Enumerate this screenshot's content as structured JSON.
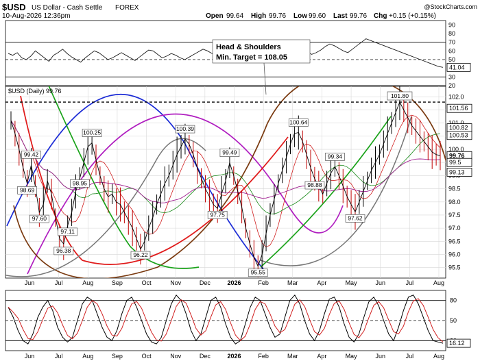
{
  "header": {
    "symbol": "$USD",
    "name": "US Dollar - Cash Settle",
    "exchange": "FOREX",
    "date": "10-Aug-2026 12:36pm",
    "open_label": "Open",
    "open": "99.64",
    "high_label": "High",
    "high": "99.76",
    "low_label": "Low",
    "low": "99.60",
    "last_label": "Last",
    "last": "99.76",
    "chg_label": "Chg",
    "chg": "+0.15 (+0.15%)",
    "watermark": "@StockCharts.com"
  },
  "annotation": {
    "line1": "Head & Shoulders",
    "line2": "Min. Target = 108.05"
  },
  "chart_data": [
    {
      "type": "line",
      "panel": "upper indicator (RSI)",
      "y_ticks": [
        20,
        30,
        40,
        50,
        60,
        70,
        80,
        90
      ],
      "ylim": [
        20,
        95
      ],
      "reference_lines": [
        30,
        50,
        70
      ],
      "last_value_label": "41.04",
      "series": [
        {
          "values": [
            57,
            55,
            58,
            52,
            50,
            54,
            60,
            56,
            52,
            48,
            55,
            58,
            62,
            57,
            53,
            50,
            47,
            52,
            56,
            60,
            58,
            54,
            50,
            52,
            55,
            58,
            55,
            52,
            49,
            53,
            57,
            61,
            60,
            56,
            52,
            54,
            57,
            55,
            52,
            50,
            53,
            56,
            59,
            62,
            60,
            57,
            54,
            52,
            55,
            58,
            60,
            58,
            55,
            52,
            50,
            53,
            56,
            58,
            56,
            54,
            52,
            55,
            58,
            61,
            64,
            62,
            59,
            56,
            58,
            61,
            65,
            68,
            66,
            63,
            60,
            58,
            62,
            66,
            70,
            74,
            72,
            70,
            68,
            66,
            64,
            62,
            60,
            58,
            56,
            54,
            52,
            50,
            48,
            46,
            44,
            42,
            41.04
          ]
        }
      ]
    },
    {
      "type": "line",
      "panel": "price",
      "title": "$USD (Daily) 99.76",
      "x_axis_labels": [
        "Jun",
        "Jul",
        "Aug",
        "Sep",
        "Oct",
        "Nov",
        "Dec",
        "2026",
        "Feb",
        "Mar",
        "Apr",
        "May",
        "Jun",
        "Jul",
        "Aug"
      ],
      "y_ticks": [
        95.5,
        96.0,
        96.5,
        97.0,
        97.5,
        98.0,
        98.5,
        99.0,
        99.5,
        100.0,
        100.5,
        101.0,
        101.5,
        102.0
      ],
      "ylim": [
        95.1,
        102.4
      ],
      "neckline": 101.8,
      "neckline_label": "101.80",
      "value_tags": [
        "101.56",
        "100.82",
        "100.53",
        "99.76",
        "99.5",
        "99.13"
      ],
      "series": [
        {
          "name": "$USD (Daily)",
          "values": [
            101.1,
            100.6,
            100.0,
            99.3,
            98.7,
            99.4,
            98.6,
            97.6,
            97.9,
            98.8,
            98.3,
            97.4,
            96.6,
            96.4,
            97.1,
            97.6,
            98.4,
            98.9,
            99.5,
            100.1,
            100.25,
            99.6,
            99.0,
            98.5,
            98.2,
            98.3,
            98.0,
            97.9,
            97.6,
            97.3,
            97.0,
            96.6,
            96.2,
            96.5,
            97.0,
            97.4,
            97.9,
            98.3,
            98.7,
            99.0,
            99.4,
            99.8,
            100.1,
            100.39,
            100.2,
            99.8,
            99.3,
            98.9,
            98.5,
            98.2,
            97.9,
            97.75,
            98.3,
            98.8,
            99.49,
            99.0,
            98.4,
            97.8,
            97.0,
            96.4,
            95.9,
            95.55,
            96.0,
            96.8,
            97.5,
            98.1,
            98.7,
            99.2,
            99.7,
            100.2,
            100.6,
            100.64,
            100.3,
            99.8,
            99.3,
            98.88,
            98.6,
            98.3,
            98.7,
            99.1,
            99.34,
            99.0,
            98.6,
            98.2,
            97.9,
            97.62,
            98.0,
            98.4,
            98.8,
            99.2,
            99.5,
            99.8,
            100.2,
            100.6,
            101.0,
            101.4,
            101.8,
            101.5,
            101.2,
            100.9,
            100.7,
            100.5,
            100.3,
            100.1,
            99.9,
            99.8,
            99.76
          ]
        }
      ],
      "point_labels": [
        {
          "text": "100.25",
          "value": 100.25
        },
        {
          "text": "99.42",
          "value": 99.42
        },
        {
          "text": "98.95",
          "value": 98.95
        },
        {
          "text": "98.69",
          "value": 98.69
        },
        {
          "text": "97.60",
          "value": 97.6
        },
        {
          "text": "97.11",
          "value": 97.11
        },
        {
          "text": "96.38",
          "value": 96.38
        },
        {
          "text": "96.22",
          "value": 96.22
        },
        {
          "text": "100.39",
          "value": 100.39
        },
        {
          "text": "99.49",
          "value": 99.49
        },
        {
          "text": "97.75",
          "value": 97.75
        },
        {
          "text": "95.55",
          "value": 95.55
        },
        {
          "text": "100.64",
          "value": 100.64
        },
        {
          "text": "98.88",
          "value": 98.88
        },
        {
          "text": "99.34",
          "value": 99.34
        },
        {
          "text": "97.62",
          "value": 97.62
        }
      ]
    },
    {
      "type": "line",
      "panel": "lower indicator (stochastic)",
      "x_axis_labels": [
        "Jun",
        "Jul",
        "Aug",
        "Sep",
        "Oct",
        "Nov",
        "Dec",
        "2026",
        "Feb",
        "Mar",
        "Apr",
        "May",
        "Jun",
        "Jul",
        "Aug"
      ],
      "y_ticks": [
        20,
        50,
        80
      ],
      "ylim": [
        5,
        95
      ],
      "reference_lines": [
        20,
        50,
        80
      ],
      "last_value_label": "16.12",
      "series": [
        {
          "values": [
            70,
            55,
            35,
            20,
            15,
            30,
            55,
            70,
            80,
            65,
            40,
            25,
            18,
            25,
            50,
            75,
            85,
            80,
            60,
            40,
            25,
            20,
            35,
            60,
            80,
            85,
            70,
            50,
            30,
            18,
            15,
            25,
            50,
            75,
            88,
            80,
            60,
            35,
            20,
            30,
            55,
            80,
            85,
            70,
            45,
            25,
            15,
            20,
            45,
            70,
            85,
            80,
            60,
            40,
            25,
            30,
            55,
            80,
            88,
            75,
            50,
            30,
            20,
            35,
            60,
            82,
            85,
            70,
            45,
            25,
            18,
            30,
            55,
            78,
            85,
            72,
            50,
            30,
            20,
            40,
            65,
            85,
            88,
            75,
            55,
            35,
            20,
            18,
            16.12
          ]
        }
      ]
    }
  ]
}
